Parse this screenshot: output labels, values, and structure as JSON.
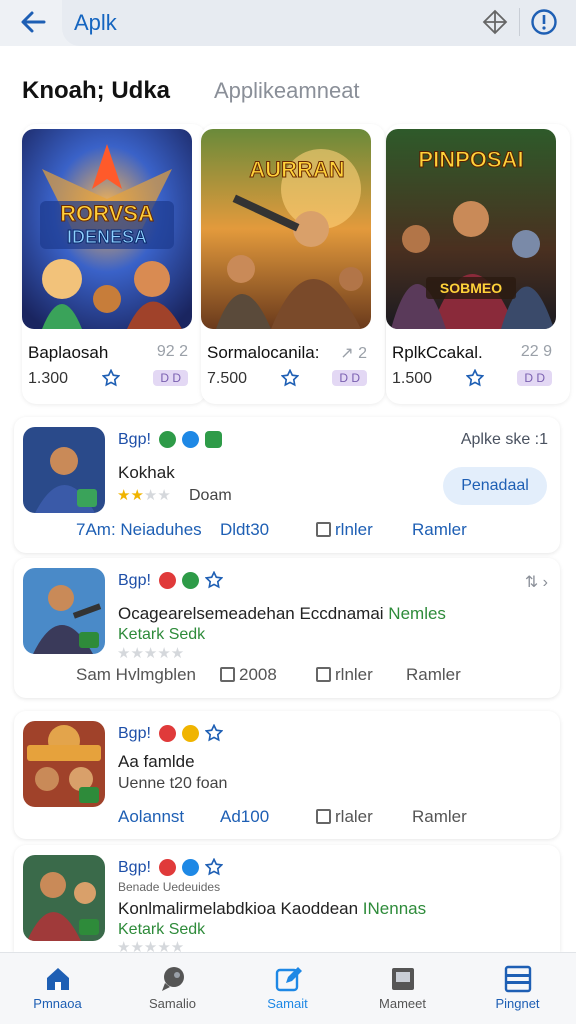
{
  "topbar": {
    "query": "Aplk",
    "back_icon": "arrow-left-icon",
    "icons": [
      "diamond-icon",
      "info-icon"
    ]
  },
  "section": {
    "title": "Knoah; Udka",
    "subtitle": "Applikeamneat"
  },
  "featured": [
    {
      "name": "Baplaosah",
      "side": "92 2",
      "count": "1.300",
      "badge": "D D",
      "art_title": "RORVSA\nIDENESA"
    },
    {
      "name": "Sormalocanila:",
      "side": "↗ 2",
      "count": "7.500",
      "badge": "D D",
      "art_title": "AURRAN"
    },
    {
      "name": "RplkCcakal.",
      "side": "22 9",
      "count": "1.500",
      "badge": "D D",
      "art_title": "PINPOSAI"
    }
  ],
  "cards": [
    {
      "tag": "Bgp!",
      "line1": "Kokhak",
      "line2": "Doam",
      "rating": 2,
      "right": "Aplke ske :1",
      "button": "Penadaal",
      "row": [
        "7Am: Neiaduhes",
        "Dldt30",
        "rlnler",
        "Ramler"
      ]
    },
    {
      "tag": "Bgp!",
      "line1": "Ocagearelsemeadehan ",
      "line1_b": "Eccdnamai",
      "line1_c": " Nemles",
      "line2": "Ketark Sedk",
      "rating": 0,
      "right": "⇅ ›",
      "row": [
        "Sam Hvlmgblen",
        "2008",
        "rlnler",
        "Ramler"
      ]
    },
    {
      "tag": "Bgp!",
      "line1": "Aa famlde",
      "line2": "Uenne t20 foan",
      "rating": null,
      "row": [
        "Aolannst",
        "Ad100",
        "rlaler",
        "Ramler"
      ]
    },
    {
      "tag": "Bgp!",
      "line0": "Benade Uedeuides",
      "line1": "Konlmalirmelabdkioa ",
      "line1_b": "Kaoddean",
      "line1_c": " INennas",
      "line2": "Ketark Sedk",
      "rating": 0
    }
  ],
  "bottom_nav": [
    {
      "label": "Pmnaoa",
      "icon": "home-icon",
      "color": "#1e5fb4",
      "active": true
    },
    {
      "label": "Samalio",
      "icon": "chat-icon",
      "color": "#555555",
      "active": false
    },
    {
      "label": "Samait",
      "icon": "edit-icon",
      "color": "#1e88e5",
      "active": true
    },
    {
      "label": "Mameet",
      "icon": "tablet-icon",
      "color": "#555555",
      "active": false
    },
    {
      "label": "Pingnet",
      "icon": "menu-icon",
      "color": "#1e5fb4",
      "active": true
    }
  ],
  "colors": {
    "accent": "#1e5fb4",
    "badge_bg": "#e3d8f4",
    "star": "#f0b400"
  }
}
